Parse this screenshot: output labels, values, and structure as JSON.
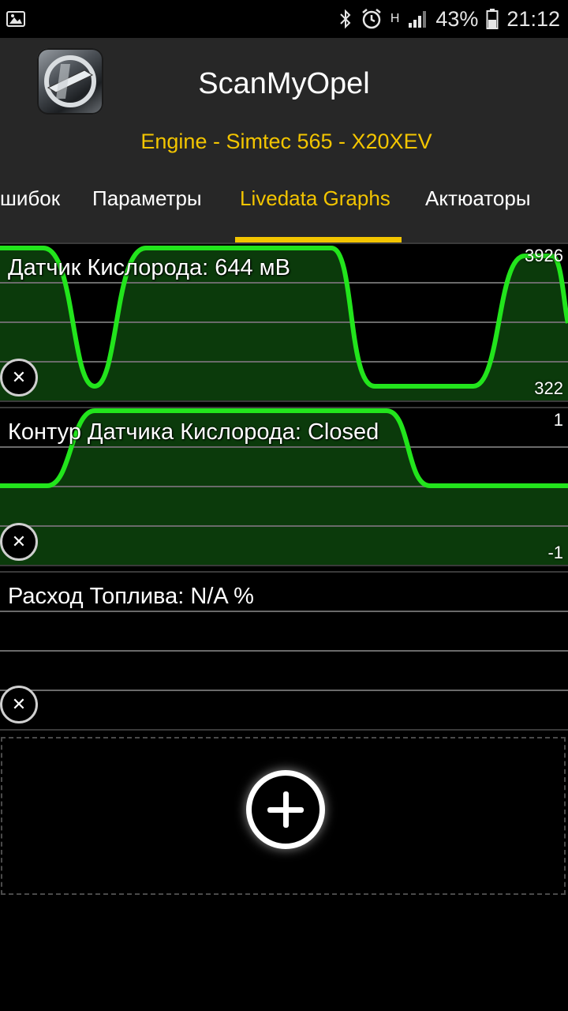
{
  "status_bar": {
    "battery": "43%",
    "time": "21:12",
    "network": "H"
  },
  "app": {
    "title": "ScanMyOpel",
    "subtitle": "Engine - Simtec 565 - X20XEV"
  },
  "tabs": [
    {
      "label": "шибок",
      "active": false
    },
    {
      "label": "Параметры",
      "active": false
    },
    {
      "label": "Livedata Graphs",
      "active": true
    },
    {
      "label": "Актюаторы",
      "active": false
    }
  ],
  "graphs": [
    {
      "label": "Датчик Кислорода: 644 мВ",
      "max": "3926",
      "min": "322"
    },
    {
      "label": "Контур Датчика Кислорода: Closed",
      "max": "1",
      "min": "-1"
    },
    {
      "label": "Расход Топлива: N/A %",
      "max": "",
      "min": ""
    }
  ],
  "colors": {
    "accent": "#f3c500",
    "trace": "#22e51c",
    "fill": "#0b3a0b",
    "header_bg": "#272727"
  }
}
